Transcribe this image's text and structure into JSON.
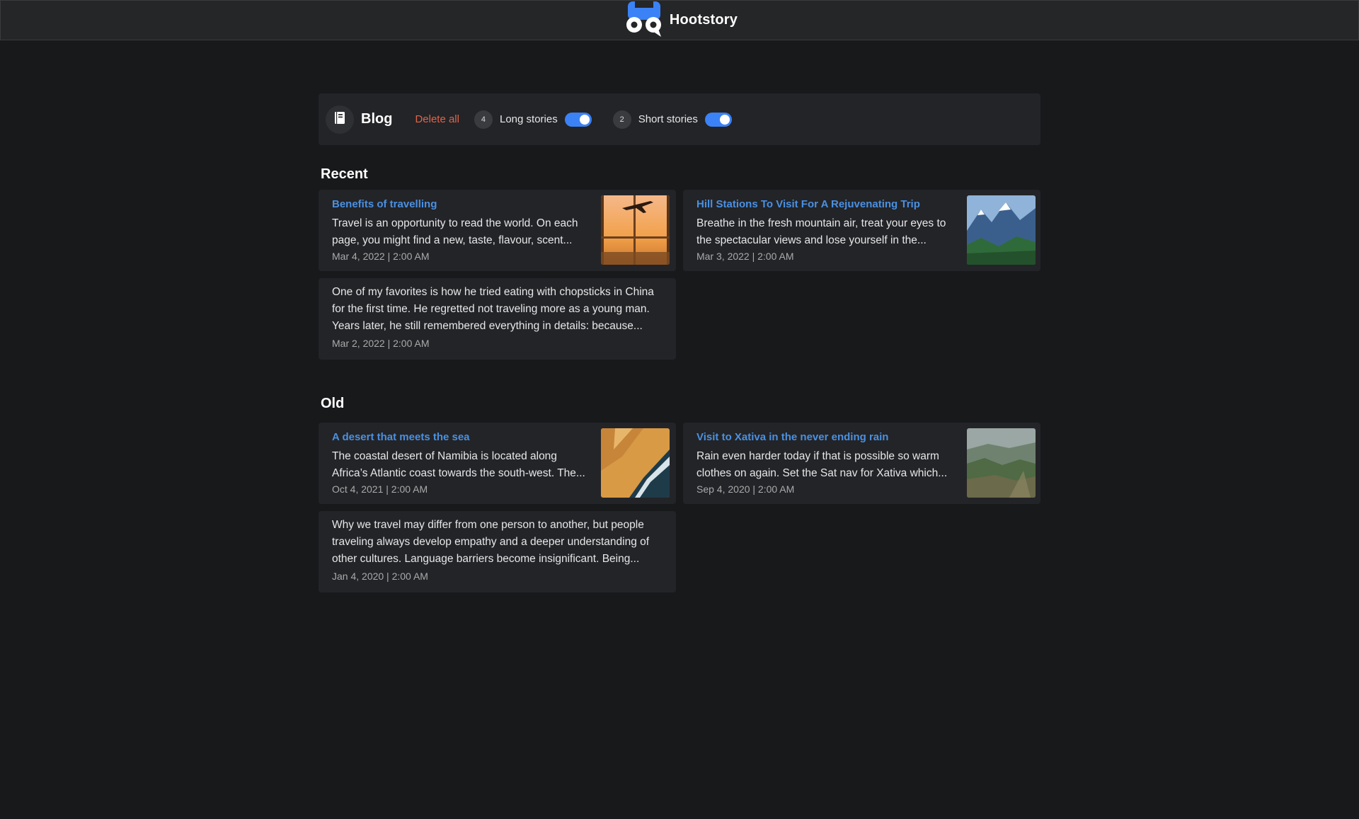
{
  "app": {
    "name": "Hootstory"
  },
  "toolbar": {
    "title": "Blog",
    "delete_all": "Delete all",
    "long": {
      "count": "4",
      "label": "Long stories",
      "on": true
    },
    "short": {
      "count": "2",
      "label": "Short stories",
      "on": true
    }
  },
  "sections": {
    "recent": {
      "title": "Recent",
      "cards": [
        {
          "title": "Benefits of travelling",
          "excerpt_1": "Travel is an opportunity to read the world.  On each",
          "excerpt_2": "page, you might find a new, taste, flavour, scent...",
          "date": "Mar 4, 2022 | 2:00 AM"
        },
        {
          "title": "Hill Stations To Visit For A Rejuvenating Trip",
          "excerpt_1": "Breathe in the fresh mountain air, treat your eyes to",
          "excerpt_2": "the spectacular views and lose yourself in the...",
          "date": "Mar 3, 2022 | 2:00 AM"
        },
        {
          "excerpt_1": "One of my favorites is how he tried eating with chopsticks in China",
          "excerpt_2": "for the first time. He regretted not traveling more as a young man.",
          "excerpt_3": "Years later, he still remembered everything in details: because...",
          "date": "Mar 2, 2022 | 2:00 AM"
        }
      ]
    },
    "old": {
      "title": "Old",
      "cards": [
        {
          "title": "A desert that meets the sea",
          "excerpt_1": "The coastal desert of Namibia is located along",
          "excerpt_2": "Africa’s Atlantic coast towards the south-west. The...",
          "date": "Oct 4, 2021 | 2:00 AM"
        },
        {
          "title": "Visit to Xativa in the never ending rain",
          "excerpt_1": "Rain even harder today if that is possible so warm",
          "excerpt_2": "clothes on again. Set the Sat nav for Xativa which...",
          "date": "Sep 4, 2020 | 2:00 AM"
        },
        {
          "excerpt_1": "Why we travel may differ from one person to another, but people",
          "excerpt_2": "traveling always develop empathy and a deeper understanding of",
          "excerpt_3": "other cultures. Language barriers become insignificant. Being...",
          "date": "Jan 4, 2020 | 2:00 AM"
        }
      ]
    }
  },
  "colors": {
    "background": "#18191b",
    "card": "#232427",
    "accent_blue": "#4a90e2",
    "toggle_on": "#3b82f6",
    "danger": "#e2634a"
  }
}
